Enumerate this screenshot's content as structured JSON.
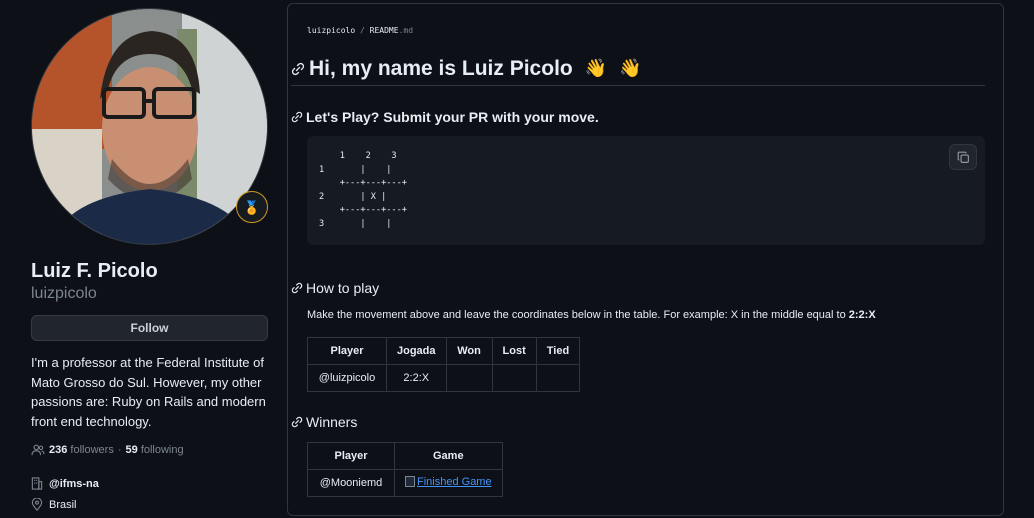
{
  "profile": {
    "full_name": "Luiz F. Picolo",
    "username": "luizpicolo",
    "follow_label": "Follow",
    "bio": "I'm a professor at the Federal Institute of Mato Grosso do Sul. However, my other passions are: Ruby on Rails and modern front end technology.",
    "followers_count": "236",
    "followers_label": "followers",
    "separator": "·",
    "following_count": "59",
    "following_label": "following",
    "organization": "@ifms-na",
    "location": "Brasil",
    "status_emoji": "🏅"
  },
  "readme": {
    "breadcrumb_user": "luizpicolo",
    "breadcrumb_sep": "/",
    "breadcrumb_file": "README",
    "breadcrumb_ext": ".md",
    "title": "Hi, my name is Luiz Picolo",
    "title_emoji_1": "👋",
    "title_emoji_2": "👋",
    "play_heading": "Let's Play? Submit your PR with your move.",
    "board": "    1    2    3\n1       |    |\n    +---+---+---+\n2       | X |\n    +---+---+---+\n3       |    |",
    "how_heading": "How to play",
    "how_text": "Make the movement above and leave the coordinates below in the table. For example: X in the middle equal to ",
    "how_example": "2:2:X",
    "moves_table": {
      "headers": [
        "Player",
        "Jogada",
        "Won",
        "Lost",
        "Tied"
      ],
      "row": [
        "@luizpicolo",
        "2:2:X",
        "",
        "",
        ""
      ]
    },
    "winners_heading": "Winners",
    "winners_table": {
      "headers": [
        "Player",
        "Game"
      ],
      "row_player": "@Mooniemd",
      "row_game": "Finished Game"
    }
  },
  "colors": {
    "background": "#0d1117",
    "border": "#30363d",
    "muted": "#7d8590",
    "link": "#4493f8"
  }
}
